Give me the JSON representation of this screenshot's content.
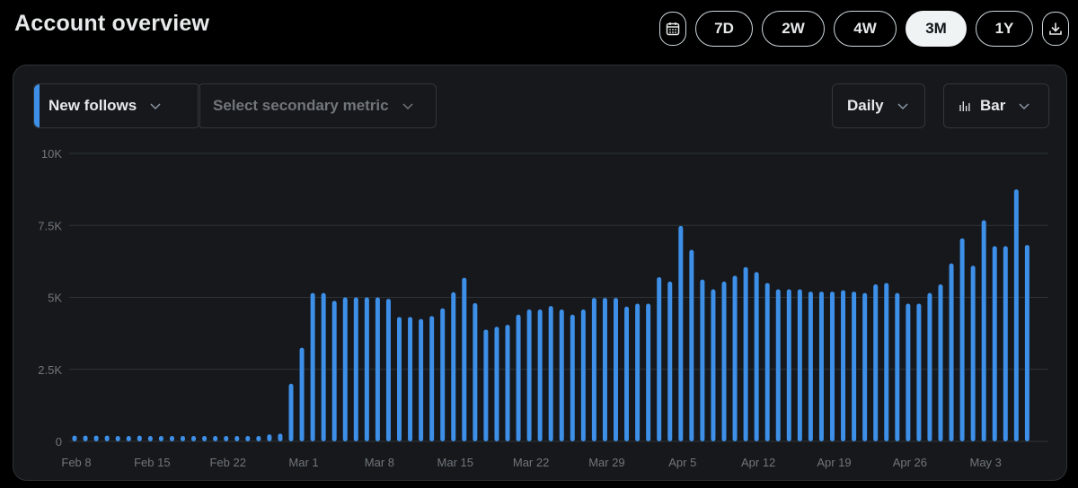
{
  "header": {
    "title": "Account overview",
    "ranges": [
      "7D",
      "2W",
      "4W",
      "3M",
      "1Y"
    ],
    "active_range": "3M",
    "calendar_icon": "calendar-icon",
    "download_icon": "download-icon"
  },
  "controls": {
    "primary_metric": "New follows",
    "secondary_metric_placeholder": "Select secondary metric",
    "interval": "Daily",
    "chart_type": "Bar",
    "chart_type_icon": "bar-chart-icon",
    "dropdown_icon": "chevron-down-icon"
  },
  "colors": {
    "bar": "#3d8fe8",
    "accent": "#3d8fe8",
    "grid": "#2f3336",
    "panel": "#16181c",
    "background": "#000000"
  },
  "chart_data": {
    "type": "bar",
    "series": [
      {
        "name": "New follows",
        "values": [
          200,
          200,
          200,
          200,
          180,
          180,
          200,
          180,
          180,
          180,
          150,
          150,
          170,
          180,
          170,
          170,
          170,
          180,
          240,
          270,
          2000,
          3250,
          5150,
          5150,
          4880,
          5000,
          5000,
          5000,
          5000,
          4950,
          4320,
          4320,
          4250,
          4350,
          4620,
          5180,
          5680,
          4800,
          3880,
          3980,
          4050,
          4400,
          4580,
          4580,
          4700,
          4580,
          4400,
          4580,
          4980,
          4980,
          4980,
          4680,
          4780,
          4780,
          5700,
          5550,
          7480,
          6650,
          5620,
          5280,
          5550,
          5750,
          6050,
          5880,
          5500,
          5280,
          5280,
          5280,
          5200,
          5200,
          5200,
          5250,
          5200,
          5150,
          5450,
          5500,
          5150,
          4780,
          4780,
          5150,
          5450,
          6180,
          7050,
          6100,
          7680,
          6780,
          6780,
          8750,
          6820
        ]
      }
    ],
    "x_start": "Feb 8",
    "x_tick_labels": [
      "Feb 8",
      "Feb 15",
      "Feb 22",
      "Mar 1",
      "Mar 8",
      "Mar 15",
      "Mar 22",
      "Mar 29",
      "Apr 5",
      "Apr 12",
      "Apr 19",
      "Apr 26",
      "May 3"
    ],
    "x_tick_every_days": 7,
    "y_ticks": [
      "0",
      "2.5K",
      "5K",
      "7.5K",
      "10K"
    ],
    "ylim": [
      0,
      10000
    ],
    "grid": true,
    "legend": "none"
  }
}
